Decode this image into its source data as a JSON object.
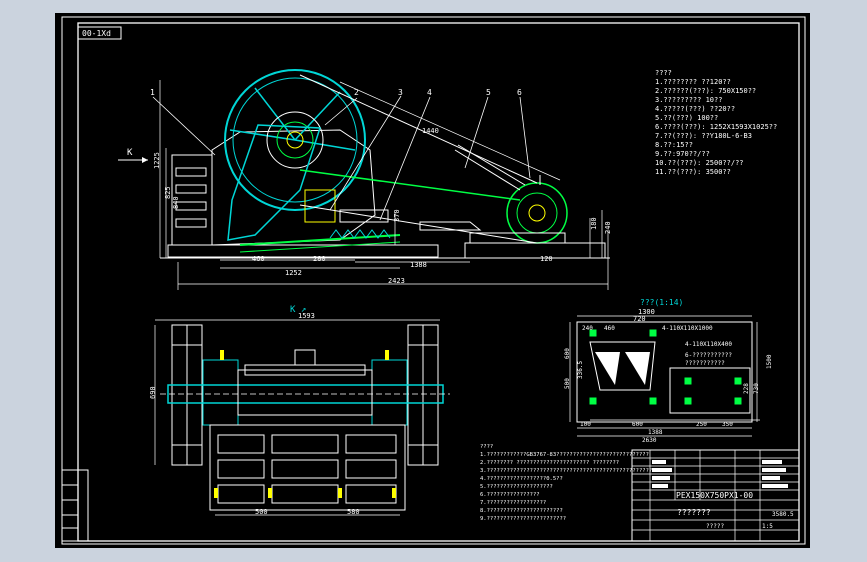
{
  "drawing": {
    "frame_tag": "00-1Xd",
    "view_label": "K ↗",
    "arrow_label": "K",
    "detail_title": "???(1:14)",
    "title_block": {
      "part_no": "PEX150X750PX1-00",
      "name_line": "???????",
      "scale": "?????",
      "sheet": "1:5",
      "mark": "3580.5"
    }
  },
  "balloons": [
    "1",
    "2",
    "3",
    "4",
    "5",
    "6"
  ],
  "dims_side": {
    "d1440": "1440",
    "d1225": "1225",
    "d825": "825",
    "d840": "840",
    "d370": "370",
    "d460": "460",
    "d280": "280",
    "d1252": "1252",
    "d1388": "1388",
    "d2423": "2423",
    "d180": "180",
    "d240": "240",
    "d120": "120"
  },
  "dims_top": {
    "d1593": "1593",
    "d690": "690",
    "d500": "500",
    "d580": "580"
  },
  "dims_detail": {
    "d1300": "1300",
    "d720": "720",
    "d240": "240",
    "d460": "460",
    "d600": "600",
    "d500": "500",
    "d1500": "1500",
    "d1180": "1180",
    "d336": "336.5",
    "d1388": "1388",
    "d2630": "2630",
    "d100": "100",
    "d250": "250",
    "d350": "350",
    "d228": "228",
    "d730": "730",
    "bolt1": "4-110X110X1000",
    "bolt2": "4-110X110X400",
    "note1": "6-???????????",
    "note2": "???????????"
  },
  "spec_lines": [
    "????",
    "1.????????      ??120??",
    "2.??????(???):   750X150??",
    "3.?????????     10??",
    "4.?????(???)     ??20??",
    "5.??(???)      100??",
    "6.????(???):   1252X1593X1025??",
    "7.??(???):      ??Y180L-6-B3",
    "8.??:15??",
    "9.??:970??/??",
    "10.??(???):      2500??/??",
    "11.??(???):       3500??"
  ],
  "tech_notes": [
    "????",
    "1.????????????GB3767-83????????????????????????????",
    "2.????????  ??????????????????????  ????????",
    "3.??????????????????????????????????????????????????",
    "4.??????????????????0.5??",
    "5.????????????????????",
    "6.????????????????",
    "7.??????????????????",
    "8.???????????????????????",
    "9.????????????????????????"
  ]
}
